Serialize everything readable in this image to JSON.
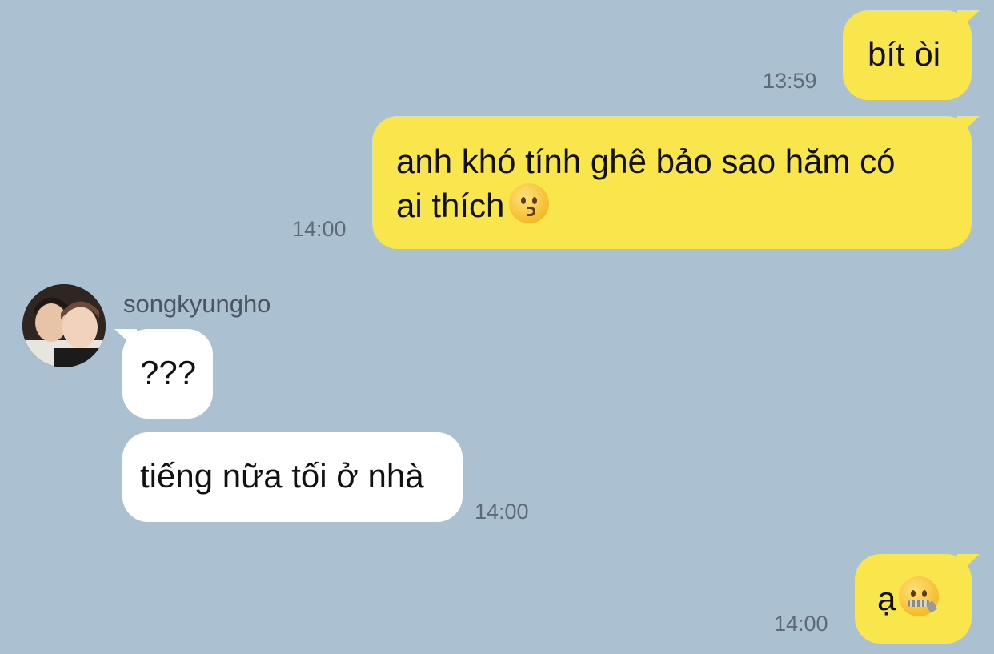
{
  "messages": [
    {
      "direction": "outgoing",
      "text": "bít òi",
      "time": "13:59"
    },
    {
      "direction": "outgoing",
      "text": "anh khó tính ghê bảo sao hăm có",
      "text2": "ai thích",
      "time": "14:00"
    },
    {
      "direction": "incoming",
      "sender": "songkyungho",
      "text": "???"
    },
    {
      "direction": "incoming",
      "text": "tiếng nữa tối ở nhà",
      "time": "14:00"
    },
    {
      "direction": "outgoing",
      "text": "ạ",
      "time": "14:00"
    }
  ],
  "icons": {
    "kiss_emoji": "kissing-face-icon",
    "zipper_emoji": "zipper-mouth-face-icon"
  },
  "colors": {
    "background": "#abc1d1",
    "outgoing_bubble": "#f9e54c",
    "incoming_bubble": "#ffffff",
    "timestamp": "#5d6b78"
  }
}
